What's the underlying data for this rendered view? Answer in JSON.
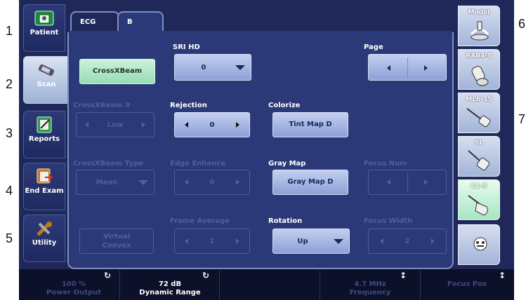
{
  "outer_labels": [
    "1",
    "2",
    "3",
    "4",
    "5",
    "6",
    "7"
  ],
  "nav": [
    {
      "label": "Patient",
      "icon": "folder-icon"
    },
    {
      "label": "Scan",
      "icon": "probe-icon"
    },
    {
      "label": "Reports",
      "icon": "report-icon"
    },
    {
      "label": "End Exam",
      "icon": "end-exam-icon"
    },
    {
      "label": "Utility",
      "icon": "wrench-icon"
    }
  ],
  "tabs": [
    "ECG",
    "B"
  ],
  "controls": {
    "crossbeam": "CrossXBeam",
    "sri_hd": {
      "label": "SRI HD",
      "value": "0"
    },
    "page": {
      "label": "Page"
    },
    "crossxbeam_level": {
      "label": "CrossXBeam #",
      "value": "Low"
    },
    "rejection": {
      "label": "Rejection",
      "value": "0"
    },
    "colorize": {
      "label": "Colorize",
      "value": "Tint Map D"
    },
    "crossxbeam_type": {
      "label": "CrossXBeam Type",
      "value": "Mean"
    },
    "edge_enhance": {
      "label": "Edge Enhance",
      "value": "0"
    },
    "gray_map": {
      "label": "Gray Map",
      "value": "Gray Map D"
    },
    "focus_num": {
      "label": "Focus Num"
    },
    "virtual_convex": "Virtual Convex",
    "frame_average": {
      "label": "Frame Average",
      "value": "1"
    },
    "rotation": {
      "label": "Rotation",
      "value": "Up"
    },
    "focus_width": {
      "label": "Focus Width",
      "value": "2"
    }
  },
  "probes": [
    {
      "label": "Model",
      "icon": "model-probe-icon"
    },
    {
      "label": "RAB4-8",
      "icon": "rab-probe-icon"
    },
    {
      "label": "ML6-15",
      "icon": "linear-probe-icon"
    },
    {
      "label": "9L",
      "icon": "linear-probe-icon"
    },
    {
      "label": "C1-5",
      "icon": "convex-probe-icon",
      "active": true
    },
    {
      "label": "",
      "icon": "settings-probe-icon"
    }
  ],
  "bottom": [
    {
      "value": "100 %",
      "label": "Power Output",
      "dim": true,
      "rotary": true
    },
    {
      "value": "72 dB",
      "label": "Dynamic Range",
      "dim": false,
      "rotary": true
    },
    {
      "value": "",
      "label": "",
      "dim": true,
      "rotary": false
    },
    {
      "value": "4.7 MHz",
      "label": "Frequency",
      "dim": true,
      "toggle": true
    },
    {
      "value": "",
      "label": "Focus Pos",
      "dim": true,
      "toggle": true
    }
  ],
  "colors": {
    "frame": "#1f2858",
    "panel": "#2b3978",
    "accent_green": "#a7e6c2"
  }
}
